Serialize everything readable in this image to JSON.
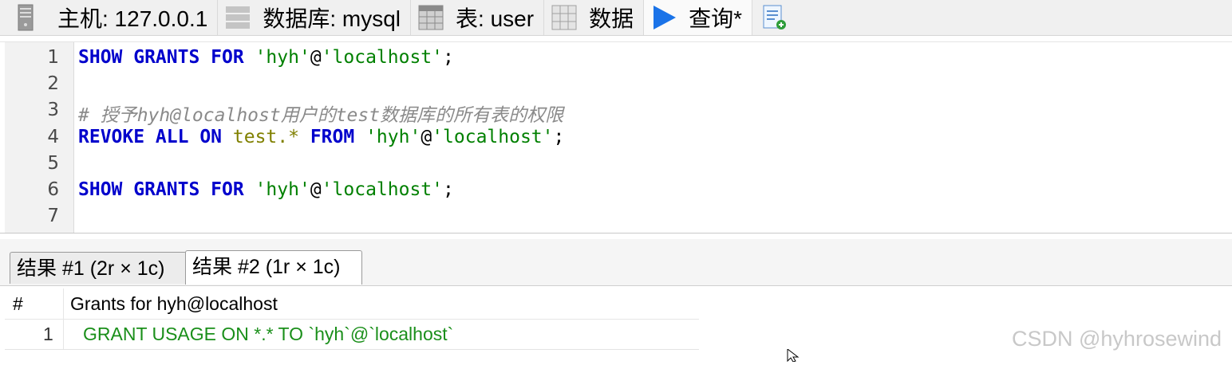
{
  "tabs": [
    {
      "label": "主机: 127.0.0.1",
      "icon": "server-icon"
    },
    {
      "label": "数据库: mysql",
      "icon": "database-icon"
    },
    {
      "label": "表: user",
      "icon": "table-icon"
    },
    {
      "label": "数据",
      "icon": "data-grid-icon"
    },
    {
      "label": "查询*",
      "icon": "play-icon"
    }
  ],
  "add_query_icon": "new-query-icon",
  "editor": {
    "line_numbers": [
      "1",
      "2",
      "3",
      "4",
      "5",
      "6",
      "7"
    ],
    "lines": [
      {
        "kw1": "SHOW GRANTS FOR",
        "str1": "'hyh'",
        "at": "@",
        "str2": "'localhost'",
        "end": ";"
      },
      {},
      {
        "comment": "# 授予hyh@localhost用户的test数据库的所有表的权限"
      },
      {
        "kw1": "REVOKE ALL ON",
        "table": "test.*",
        "kw2": "FROM",
        "str1": "'hyh'",
        "at": "@",
        "str2": "'localhost'",
        "end": ";"
      },
      {},
      {
        "kw1": "SHOW GRANTS FOR",
        "str1": "'hyh'",
        "at": "@",
        "str2": "'localhost'",
        "end": ";"
      },
      {}
    ]
  },
  "result_tabs": [
    "结果 #1 (2r × 1c)",
    "结果 #2 (1r × 1c)"
  ],
  "result_grid": {
    "columns": [
      "#",
      "Grants for hyh@localhost"
    ],
    "rows": [
      {
        "num": "1",
        "value": "GRANT USAGE ON *.* TO `hyh`@`localhost`"
      }
    ]
  },
  "watermark": "CSDN @hyhrosewind",
  "colors": {
    "keyword": "#0000cc",
    "string": "#008000",
    "comment": "#8a8a8a",
    "table_ref": "#808000",
    "play": "#1a73e8"
  }
}
